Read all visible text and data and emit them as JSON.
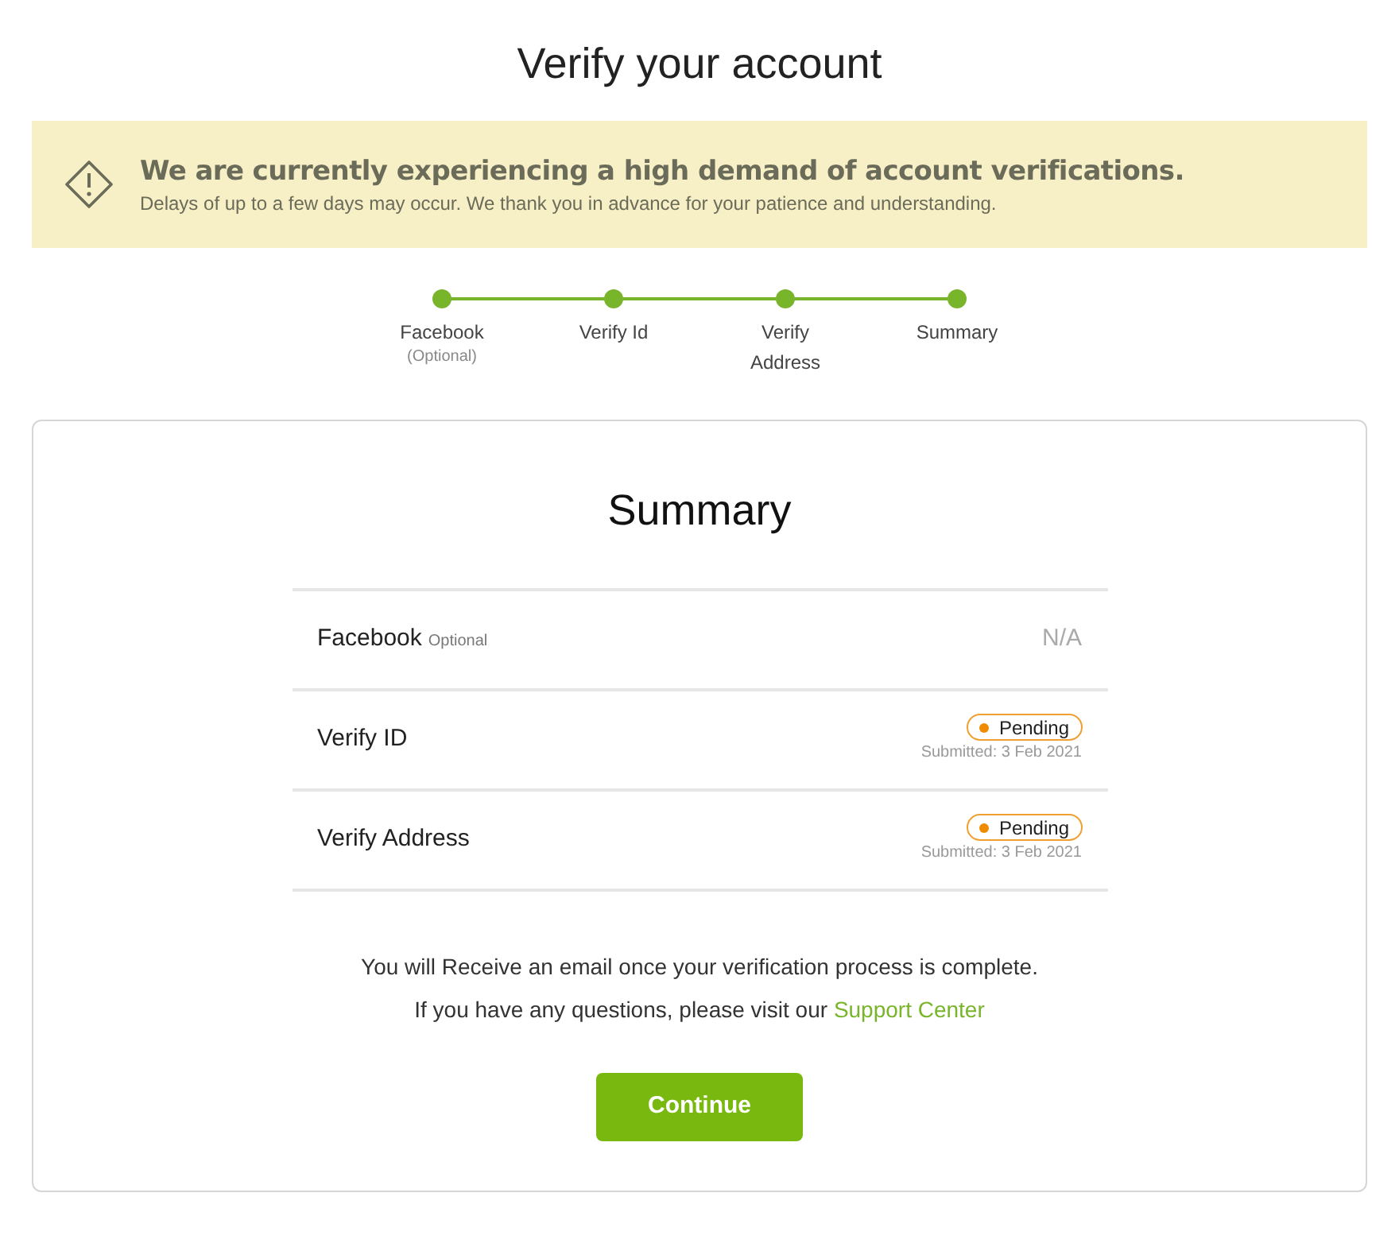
{
  "title": "Verify your account",
  "notice": {
    "heading": "We are currently experiencing a high demand of account verifications.",
    "body": "Delays of up to a few days may occur. We thank you in advance for your patience and understanding."
  },
  "steps": [
    {
      "label": "Facebook",
      "note": "(Optional)",
      "done": true
    },
    {
      "label": "Verify Id",
      "done": true
    },
    {
      "label": "Verify Address",
      "done": true
    },
    {
      "label": "Summary",
      "done": true
    }
  ],
  "card": {
    "title": "Summary",
    "rows": [
      {
        "kind": "na",
        "label": "Facebook",
        "note": "Optional",
        "value": "N/A"
      },
      {
        "kind": "status",
        "label": "Verify ID",
        "status": "Pending",
        "submitted": "Submitted: 3 Feb 2021"
      },
      {
        "kind": "status",
        "label": "Verify Address",
        "status": "Pending",
        "submitted": "Submitted: 3 Feb 2021"
      }
    ],
    "message": "You will Receive an email once your verification process is complete.",
    "question": "If you have any questions, please visit our",
    "link": "Support Center",
    "button": "Continue"
  }
}
